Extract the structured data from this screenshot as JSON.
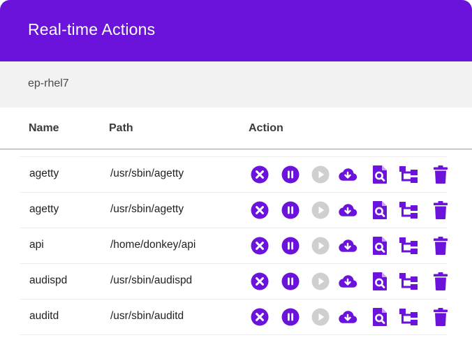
{
  "header": {
    "title": "Real-time Actions"
  },
  "host": {
    "name": "ep-rhel7"
  },
  "table": {
    "columns": {
      "name": "Name",
      "path": "Path",
      "action": "Action"
    },
    "rows": [
      {
        "name": "agetty",
        "path": "/usr/sbin/agetty"
      },
      {
        "name": "agetty",
        "path": "/usr/sbin/agetty"
      },
      {
        "name": "api",
        "path": "/home/donkey/api"
      },
      {
        "name": "audispd",
        "path": "/usr/sbin/audispd"
      },
      {
        "name": "auditd",
        "path": "/usr/sbin/auditd"
      }
    ]
  },
  "actions": [
    {
      "icon": "close-circle-icon",
      "name": "kill"
    },
    {
      "icon": "pause-circle-icon",
      "name": "suspend"
    },
    {
      "icon": "play-circle-icon",
      "name": "resume",
      "disabled": true
    },
    {
      "icon": "cloud-download-icon",
      "name": "download"
    },
    {
      "icon": "file-search-icon",
      "name": "analyze"
    },
    {
      "icon": "process-tree-icon",
      "name": "tree"
    },
    {
      "icon": "trash-icon",
      "name": "delete"
    }
  ],
  "colors": {
    "brand": "#6B12DB",
    "disabled": "#CFCFCF",
    "header_text": "#FFFFFF",
    "subbar_bg": "#F2F2F2"
  }
}
